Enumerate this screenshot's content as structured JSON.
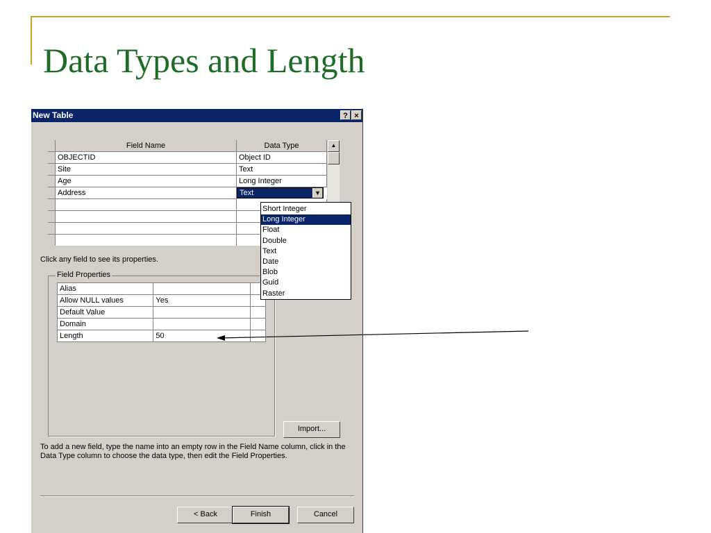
{
  "slide": {
    "title": "Data Types and Length"
  },
  "dialog": {
    "title": "New Table",
    "help_label": "?",
    "close_label": "×",
    "fields_grid": {
      "headers": {
        "field_name": "Field Name",
        "data_type": "Data Type"
      },
      "rows": [
        {
          "field_name": "OBJECTID",
          "data_type": "Object ID"
        },
        {
          "field_name": "Site",
          "data_type": "Text"
        },
        {
          "field_name": "Age",
          "data_type": "Long Integer"
        },
        {
          "field_name": "Address",
          "data_type": "Text"
        }
      ],
      "data_type_dropdown": {
        "selected": "Long Integer",
        "options": [
          "Short Integer",
          "Long Integer",
          "Float",
          "Double",
          "Text",
          "Date",
          "Blob",
          "Guid",
          "Raster"
        ]
      }
    },
    "hint": "Click any field to see its properties.",
    "field_properties": {
      "label": "Field Properties",
      "rows": [
        {
          "name": "Alias",
          "value": ""
        },
        {
          "name": "Allow NULL values",
          "value": "Yes"
        },
        {
          "name": "Default Value",
          "value": ""
        },
        {
          "name": "Domain",
          "value": ""
        },
        {
          "name": "Length",
          "value": "50"
        }
      ]
    },
    "import_label": "Import...",
    "instructions": "To add a new field, type the name into an empty row in the Field Name column, click in the Data Type column to choose the data type, then edit the Field Properties.",
    "buttons": {
      "back": "< Back",
      "finish": "Finish",
      "cancel": "Cancel"
    }
  },
  "colors": {
    "title_green": "#1f6b2a",
    "accent_gold": "#c8a028",
    "titlebar_navy": "#0a246a",
    "dialog_gray": "#d4d0c8"
  }
}
